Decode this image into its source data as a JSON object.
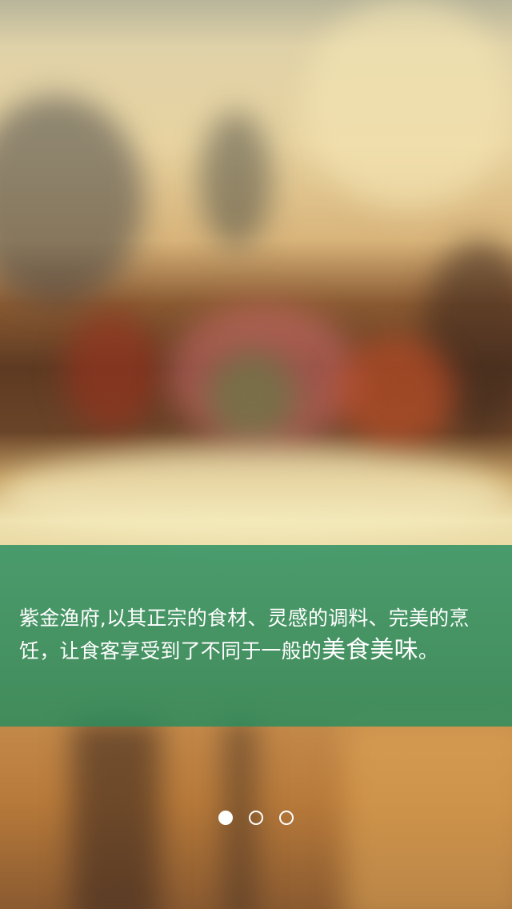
{
  "slide": {
    "caption_prefix": "紫金渔府,以其正宗的食材、灵感的调料、完美的烹饪，让食客享受到了不同于一般的",
    "caption_highlight": "美食美味",
    "caption_suffix": "。"
  },
  "pager": {
    "total": 3,
    "active_index": 0
  },
  "colors": {
    "caption_band": "#268c5f",
    "caption_text": "#ffffff",
    "dot": "#ffffff"
  }
}
